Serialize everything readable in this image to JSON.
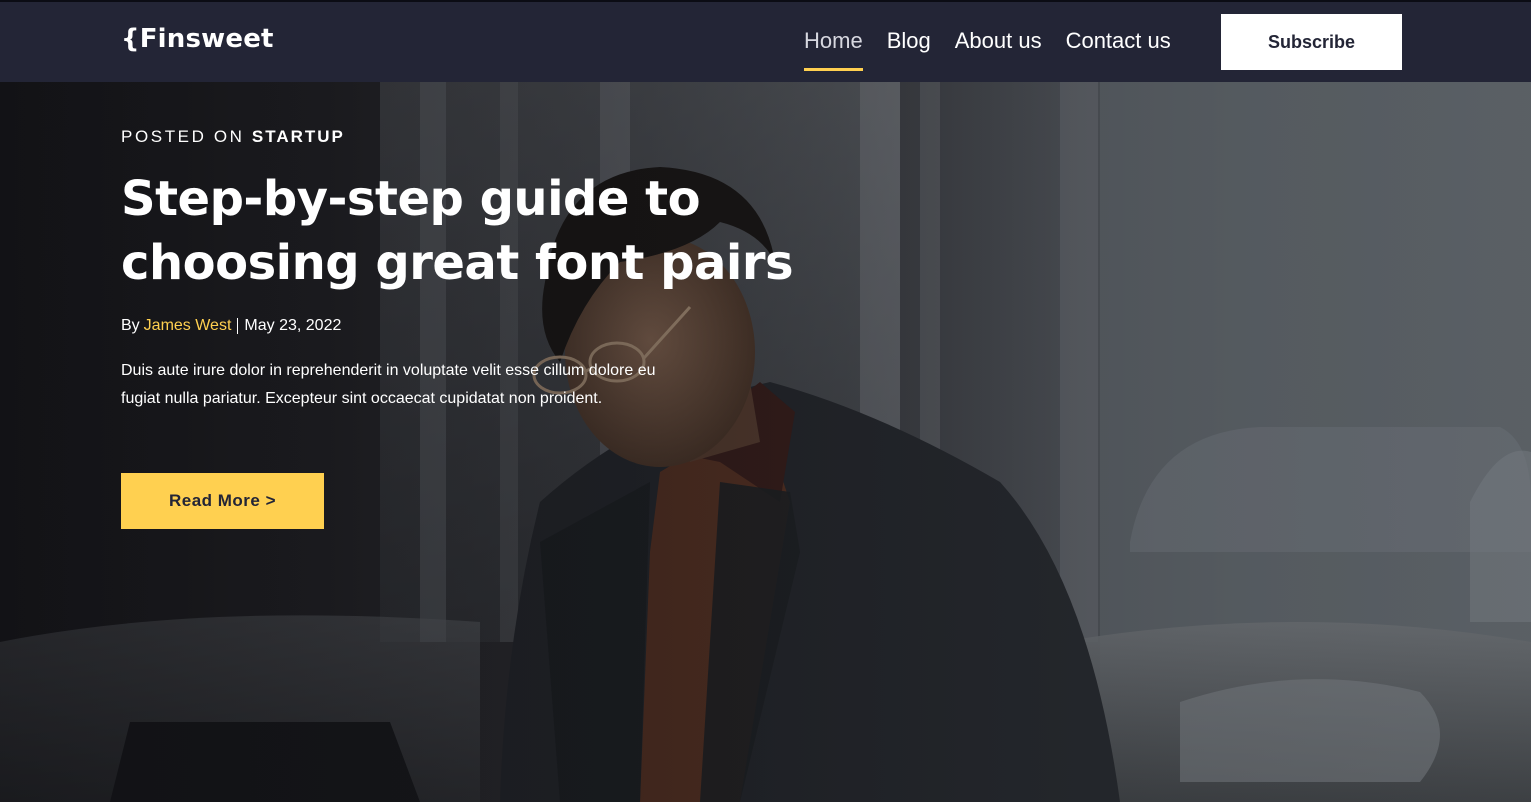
{
  "header": {
    "logo": "{Finsweet",
    "nav": [
      {
        "label": "Home",
        "active": true
      },
      {
        "label": "Blog",
        "active": false
      },
      {
        "label": "About us",
        "active": false
      },
      {
        "label": "Contact us",
        "active": false
      }
    ],
    "subscribe_label": "Subscribe"
  },
  "hero": {
    "posted_prefix": "POSTED ON",
    "category": "STARTUP",
    "title": "Step-by-step guide to choosing great font pairs",
    "by_prefix": "By",
    "author": "James West",
    "date": "May 23, 2022",
    "excerpt": "Duis aute irure dolor in reprehenderit in voluptate velit esse cillum dolore eu fugiat nulla pariatur. Excepteur sint occaecat cupidatat non proident.",
    "cta_label": "Read More >"
  },
  "colors": {
    "navbar_bg": "#232536",
    "accent_yellow": "#ffd050",
    "text_white": "#ffffff"
  }
}
